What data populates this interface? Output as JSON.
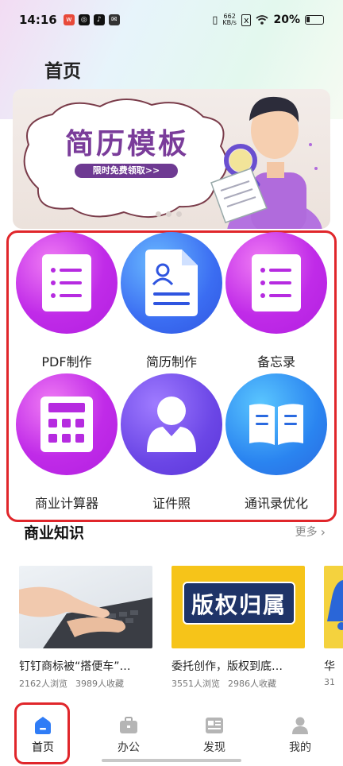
{
  "status_bar": {
    "time": "14:16",
    "net_speed_value": "662",
    "net_speed_unit": "KB/s",
    "battery": "20%"
  },
  "page": {
    "title": "首页"
  },
  "banner": {
    "heading": "简历模板",
    "button_label": "限时免费领取>>",
    "slide_count": 3
  },
  "features": [
    {
      "label": "PDF制作",
      "icon": "document-list-icon"
    },
    {
      "label": "简历制作",
      "icon": "resume-icon"
    },
    {
      "label": "备忘录",
      "icon": "memo-list-icon"
    },
    {
      "label": "商业计算器",
      "icon": "calculator-icon"
    },
    {
      "label": "证件照",
      "icon": "id-photo-icon"
    },
    {
      "label": "通讯录优化",
      "icon": "book-icon"
    }
  ],
  "knowledge": {
    "title": "商业知识",
    "more_label": "更多",
    "cards": [
      {
        "title": "钉钉商标被“搭便车”…",
        "views": "2162人浏览",
        "favorites": "3989人收藏"
      },
      {
        "title": "委托创作，版权到底…",
        "views": "3551人浏览",
        "favorites": "2986人收藏",
        "thumb_text": "版权归属"
      },
      {
        "title": "华",
        "views": "31",
        "favorites": ""
      }
    ]
  },
  "tab_bar": {
    "tabs": [
      {
        "label": "首页",
        "icon": "home-icon",
        "active": true
      },
      {
        "label": "办公",
        "icon": "briefcase-icon",
        "active": false
      },
      {
        "label": "发现",
        "icon": "news-icon",
        "active": false
      },
      {
        "label": "我的",
        "icon": "user-icon",
        "active": false
      }
    ]
  },
  "colors": {
    "highlight": "#e0262b",
    "banner_purple": "#7a3c9a"
  }
}
